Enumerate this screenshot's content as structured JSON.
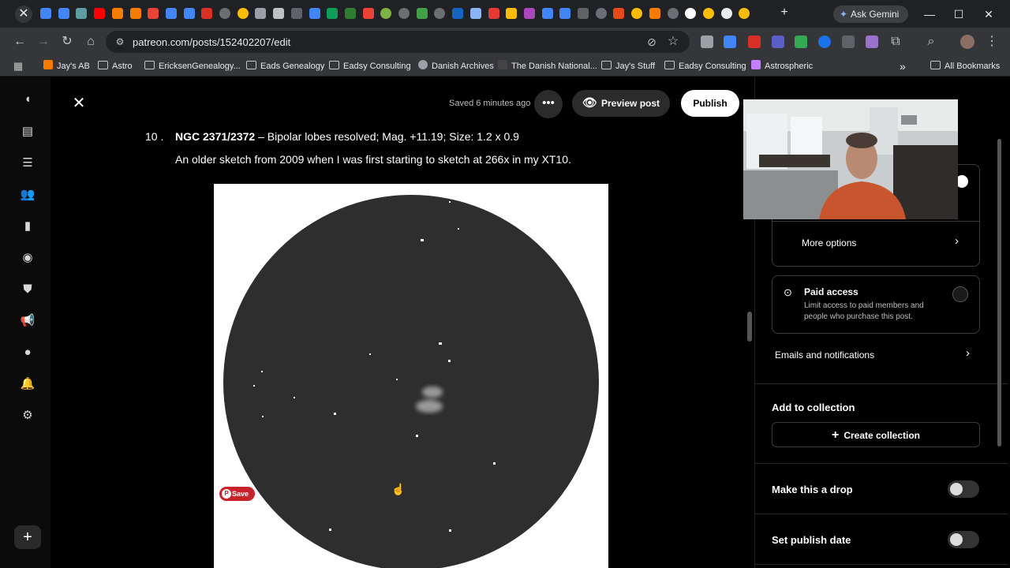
{
  "browser": {
    "tab_close_glyph": "✕",
    "pinned_tab_icons": [
      "docs-icon",
      "docs-icon",
      "cloud-icon",
      "youtube-icon",
      "blogger-icon",
      "blogger-icon",
      "maps-icon",
      "docs-icon",
      "docs-icon",
      "gmail-icon",
      "globe-icon",
      "chrome-icon",
      "edit-icon",
      "pen-icon",
      "camera-icon",
      "docs-icon",
      "sheets-icon",
      "astro-icon",
      "maps-icon",
      "compass-icon",
      "globe-icon",
      "frog-icon",
      "globe-icon",
      "m-icon",
      "sparkle-icon",
      "app-icon",
      "drive-icon",
      "colorwheel-icon",
      "docs-icon",
      "docs-icon",
      "arrow-icon",
      "globe-icon",
      "zc-icon",
      "chrome-icon",
      "blogger-icon",
      "globe-icon",
      "patreon-icon",
      "chrome-icon",
      "moon-icon",
      "chrome-icon"
    ],
    "new_tab_glyph": "+",
    "gemini_label": "Ask Gemini",
    "window_controls": {
      "minimize": "—",
      "maximize": "☐",
      "close": "✕"
    },
    "url": "patreon.com/posts/152402207/edit",
    "bookmarks": [
      {
        "label": "Jay's AB",
        "icon": "blogger-icon"
      },
      {
        "label": "Astro",
        "icon": "folder-icon"
      },
      {
        "label": "EricksenGenealogy...",
        "icon": "folder-icon"
      },
      {
        "label": "Eads Genealogy",
        "icon": "folder-icon"
      },
      {
        "label": "Eadsy Consulting",
        "icon": "folder-icon"
      },
      {
        "label": "Danish Archives",
        "icon": "globe-icon"
      },
      {
        "label": "The Danish National...",
        "icon": "crown-icon"
      },
      {
        "label": "Jay's Stuff",
        "icon": "folder-icon"
      },
      {
        "label": "Eadsy Consulting",
        "icon": "folder-icon"
      },
      {
        "label": "Astrospheric",
        "icon": "astro-icon"
      }
    ],
    "bookmarks_overflow": "»",
    "all_bookmarks": "All Bookmarks"
  },
  "editor": {
    "close_glyph": "✕",
    "saved_status": "Saved 6 minutes ago",
    "more_glyph": "•••",
    "preview_label": "Preview post",
    "publish_label": "Publish",
    "item_number": "10 .",
    "item_object": "NGC 2371/2372",
    "item_details": "– Bipolar lobes resolved; Mag. +11.19; Size: 1.2 x 0.9",
    "item_description": "An older sketch from 2009 when I was first starting to sketch at 266x in my XT10.",
    "pin_save_label": "Save"
  },
  "settings": {
    "more_options": "More options",
    "paid_access_title": "Paid access",
    "paid_access_desc_1": "Limit access to paid members and",
    "paid_access_desc_2": "people who purchase this post.",
    "emails_notifications": "Emails and notifications",
    "add_to_collection": "Add to collection",
    "create_collection": "Create collection",
    "make_drop": "Make this a drop",
    "set_publish_date": "Set publish date",
    "chevron_glyph": "›",
    "plus_glyph": "+"
  },
  "colors": {
    "browser_dark": "#202124",
    "toolbar": "#35363a",
    "publish_bg": "#ffffff",
    "pin_red": "#c8232c",
    "sketch_field": "#2e2e2e"
  }
}
